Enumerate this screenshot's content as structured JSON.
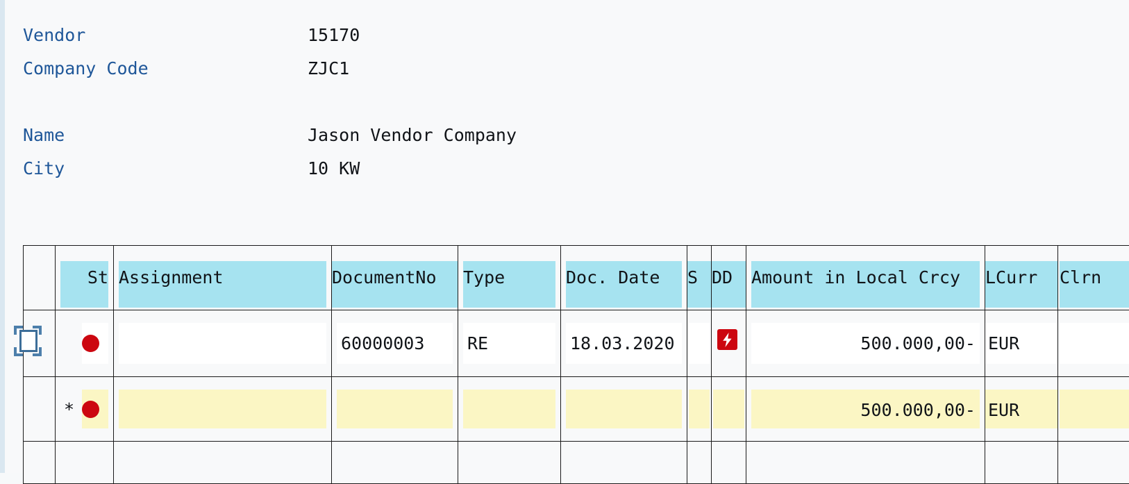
{
  "info": {
    "rows": [
      {
        "label": "Vendor",
        "value": "15170"
      },
      {
        "label": "Company Code",
        "value": "ZJC1"
      },
      {
        "label": "",
        "value": ""
      },
      {
        "label": "Name",
        "value": "Jason Vendor Company"
      },
      {
        "label": "City",
        "value": "10 KW"
      }
    ]
  },
  "table": {
    "columns": [
      {
        "key": "sel",
        "label": "",
        "align": "left"
      },
      {
        "key": "st",
        "label": "St",
        "align": "right"
      },
      {
        "key": "assignment",
        "label": "Assignment",
        "align": "left"
      },
      {
        "key": "documentno",
        "label": "DocumentNo",
        "align": "left"
      },
      {
        "key": "type",
        "label": "Type",
        "align": "left"
      },
      {
        "key": "docdate",
        "label": "Doc. Date",
        "align": "left"
      },
      {
        "key": "s",
        "label": "S",
        "align": "left"
      },
      {
        "key": "dd",
        "label": "DD",
        "align": "left"
      },
      {
        "key": "amount",
        "label": "Amount in Local Crcy",
        "align": "left"
      },
      {
        "key": "lcurr",
        "label": "LCurr",
        "align": "left"
      },
      {
        "key": "clrn",
        "label": "Clrn",
        "align": "left"
      }
    ],
    "rows": [
      {
        "kind": "item",
        "selected": true,
        "status": "red",
        "status_color": "#cc0710",
        "assignment": "",
        "documentno": "60000003",
        "type": "RE",
        "docdate": "18.03.2020",
        "s": "",
        "dd_icon": "lightning-icon",
        "amount": "500.000,00-",
        "lcurr": "EUR",
        "clrn": ""
      },
      {
        "kind": "subtotal",
        "selected": false,
        "marker": "*",
        "status": "red",
        "status_color": "#cc0710",
        "assignment": "",
        "documentno": "",
        "type": "",
        "docdate": "",
        "s": "",
        "dd_icon": "",
        "amount": "500.000,00-",
        "lcurr": "EUR",
        "clrn": ""
      },
      {
        "kind": "partial",
        "selected": false,
        "status": "",
        "assignment": "",
        "documentno": "",
        "type": "",
        "docdate": "",
        "s": "",
        "dd_icon": "",
        "amount": "",
        "lcurr": "",
        "clrn": ""
      }
    ]
  },
  "colors": {
    "header_highlight": "#a6e3f0",
    "subtotal_highlight": "#fbf6c4",
    "status_red": "#cc0710",
    "label_blue": "#1f5799",
    "page_background": "#f8f9fa",
    "grid_line": "#1a1a1a"
  }
}
